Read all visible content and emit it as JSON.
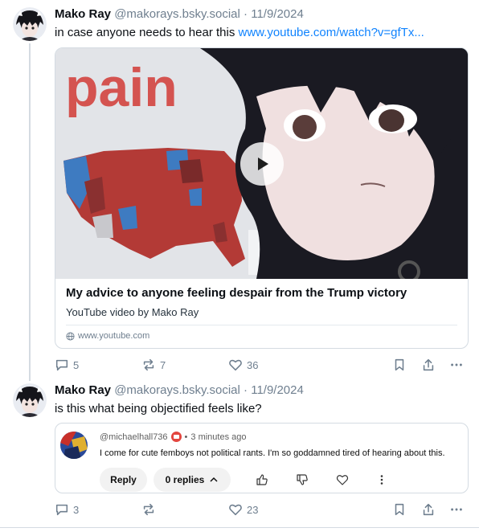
{
  "posts": [
    {
      "author_name": "Mako Ray",
      "handle": "@makorays.bsky.social",
      "separator": "·",
      "date": "11/9/2024",
      "text": "in case anyone needs to hear this ",
      "link_text": "www.youtube.com/watch?v=gfTx...",
      "card": {
        "thumb_word": "pain",
        "title": "My advice to anyone feeling despair from the Trump victory",
        "description": "YouTube video by Mako Ray",
        "domain": "www.youtube.com"
      },
      "stats": {
        "replies": "5",
        "reposts": "7",
        "likes": "36"
      }
    },
    {
      "author_name": "Mako Ray",
      "handle": "@makorays.bsky.social",
      "separator": "·",
      "date": "11/9/2024",
      "text": "is this what being objectified feels like?",
      "embed": {
        "commenter": "@michaelhall736",
        "dot": "•",
        "time": "3 minutes ago",
        "comment": "I come for cute femboys not political rants. I'm so goddamned tired of hearing about this.",
        "reply_label": "Reply",
        "replies_label": "0 replies"
      },
      "stats": {
        "replies": "3",
        "reposts": "",
        "likes": "23"
      }
    }
  ],
  "colors": {
    "link": "#1083fe",
    "muted": "#6f7f8f",
    "border": "#d4dbe2"
  },
  "icons": [
    "reply-icon",
    "repost-icon",
    "like-icon",
    "bookmark-icon",
    "share-icon",
    "more-icon",
    "play-icon",
    "globe-icon",
    "thumbs-up-icon",
    "thumbs-down-icon",
    "heart-icon",
    "kebab-icon",
    "chevron-up-icon"
  ]
}
